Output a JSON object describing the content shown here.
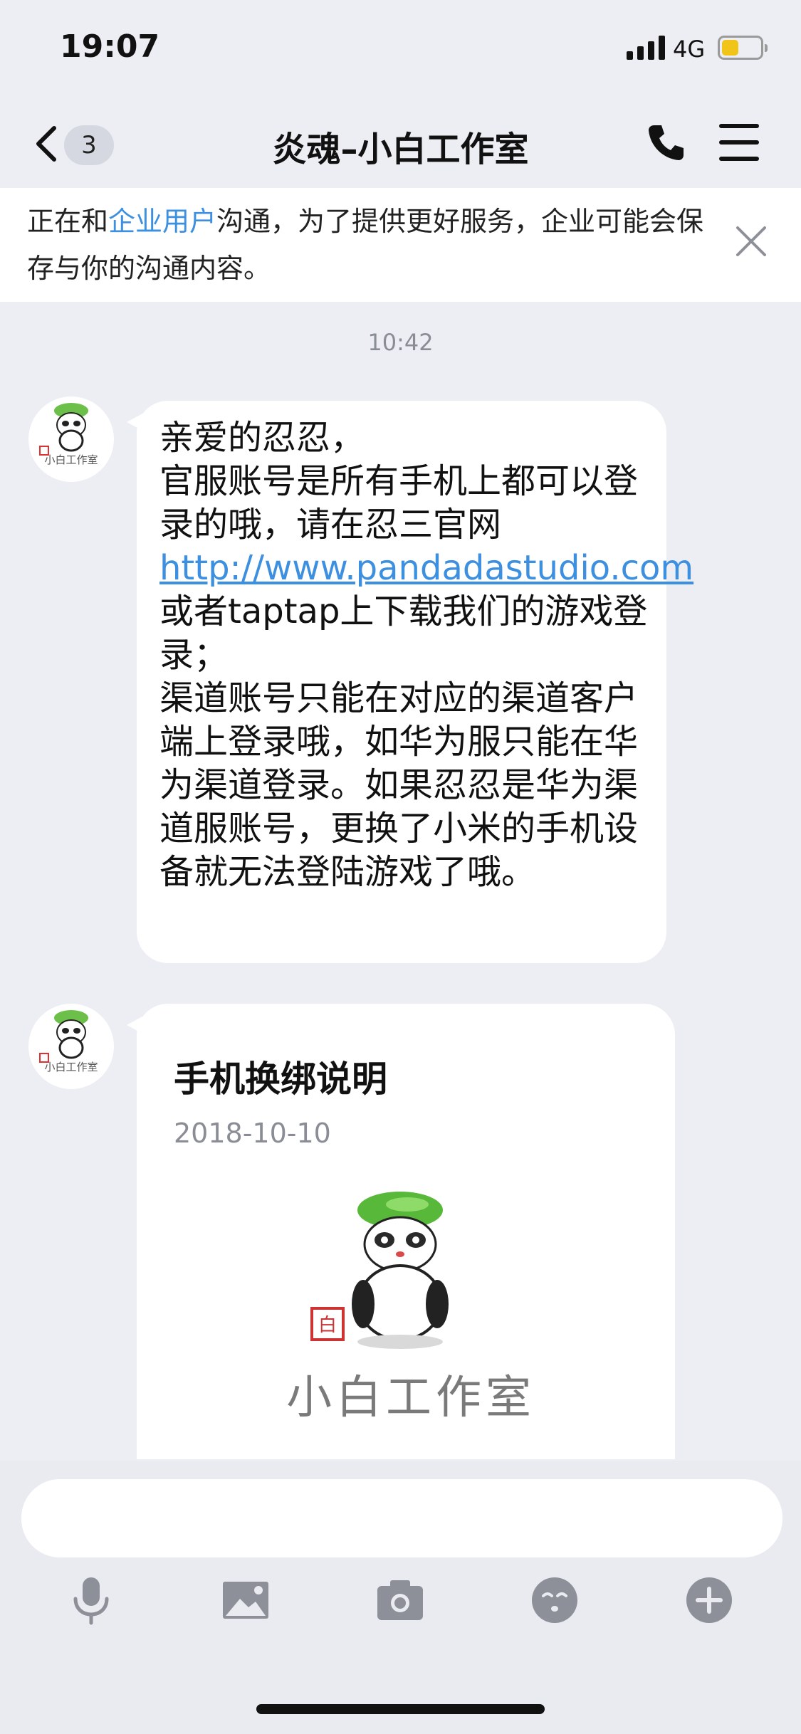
{
  "status_bar": {
    "time": "19:07",
    "network": "4G",
    "battery_level": 0.45
  },
  "nav": {
    "back_icon": "chevron-left-icon",
    "unread_count": "3",
    "title": "炎魂–小白工作室",
    "call_icon": "phone-icon",
    "menu_icon": "menu-icon"
  },
  "notice": {
    "prefix": "正在和",
    "link": "企业用户",
    "suffix": "沟通，为了提供更好服务，企业可能会保存与你的沟通内容。",
    "close_icon": "close-icon"
  },
  "timestamp": "10:42",
  "messages": [
    {
      "sender_avatar": "xiaobai-studio-avatar",
      "line1": "亲爱的忍忍，",
      "line2": "官服账号是所有手机上都可以登录的哦，请在忍三官网",
      "link": "http://www.pandadastudio.com",
      "line3": "或者taptap上下载我们的游戏登录；",
      "line4": "渠道账号只能在对应的渠道客户端上登录哦，如华为服只能在华为渠道登录。如果忍忍是华为渠道服账号，更换了小米的手机设备就无法登陆游戏了哦。"
    },
    {
      "sender_avatar": "xiaobai-studio-avatar",
      "card_title": "手机换绑说明",
      "card_date": "2018-10-10",
      "card_brand": "小白工作室",
      "seal_text": "白"
    }
  ],
  "input": {
    "placeholder": ""
  },
  "toolbar": {
    "icons": [
      "microphone-icon",
      "image-icon",
      "camera-icon",
      "emoji-icon",
      "plus-icon"
    ]
  },
  "colors": {
    "accent": "#3d8fe0",
    "background": "#eceef4",
    "icon_gray": "#8e9099",
    "battery": "#f0c419"
  }
}
